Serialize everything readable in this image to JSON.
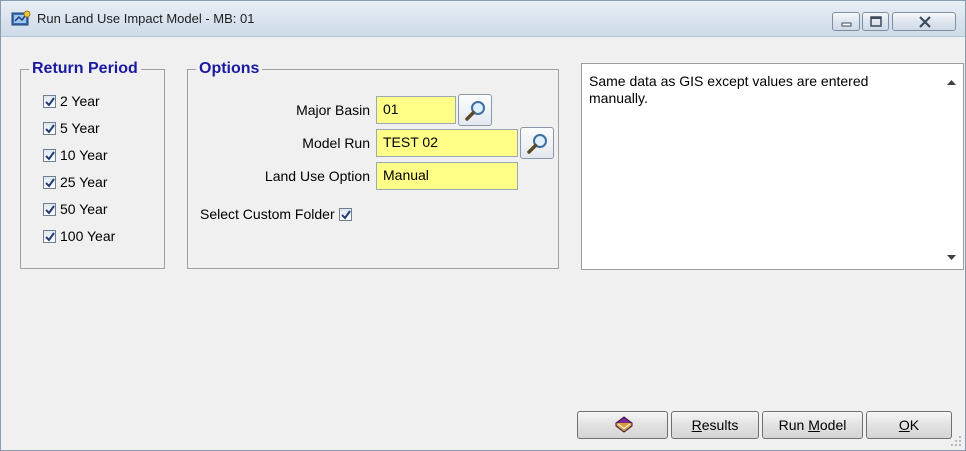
{
  "window": {
    "title": "Run Land Use Impact Model - MB: 01",
    "controls": [
      "minimize-icon",
      "maximize-icon",
      "close-icon"
    ]
  },
  "return_period": {
    "legend": "Return Period",
    "items": [
      {
        "label": "2 Year",
        "checked": true
      },
      {
        "label": "5 Year",
        "checked": true
      },
      {
        "label": "10 Year",
        "checked": true
      },
      {
        "label": "25 Year",
        "checked": true
      },
      {
        "label": "50 Year",
        "checked": true
      },
      {
        "label": "100 Year",
        "checked": true
      }
    ]
  },
  "options": {
    "legend": "Options",
    "major_basin": {
      "label": "Major Basin",
      "value": "01"
    },
    "model_run": {
      "label": "Model Run",
      "value": "TEST 02"
    },
    "land_use_option": {
      "label": "Land Use Option",
      "value": "Manual"
    },
    "custom_folder": {
      "label": "Select Custom Folder",
      "checked": true
    }
  },
  "description": {
    "text": "Same data as GIS except values are entered manually."
  },
  "buttons": {
    "help_icon": "book-icon",
    "results_prefix": "",
    "results_mnemonic": "R",
    "results_rest": "esults",
    "run_model_prefix": "Run ",
    "run_model_mnemonic": "M",
    "run_model_rest": "odel",
    "ok_mnemonic": "O",
    "ok_rest": "K"
  },
  "colors": {
    "legend_text": "#1a1aa0",
    "field_bg": "#ffff88",
    "window_bg": "#f0f0f0"
  }
}
